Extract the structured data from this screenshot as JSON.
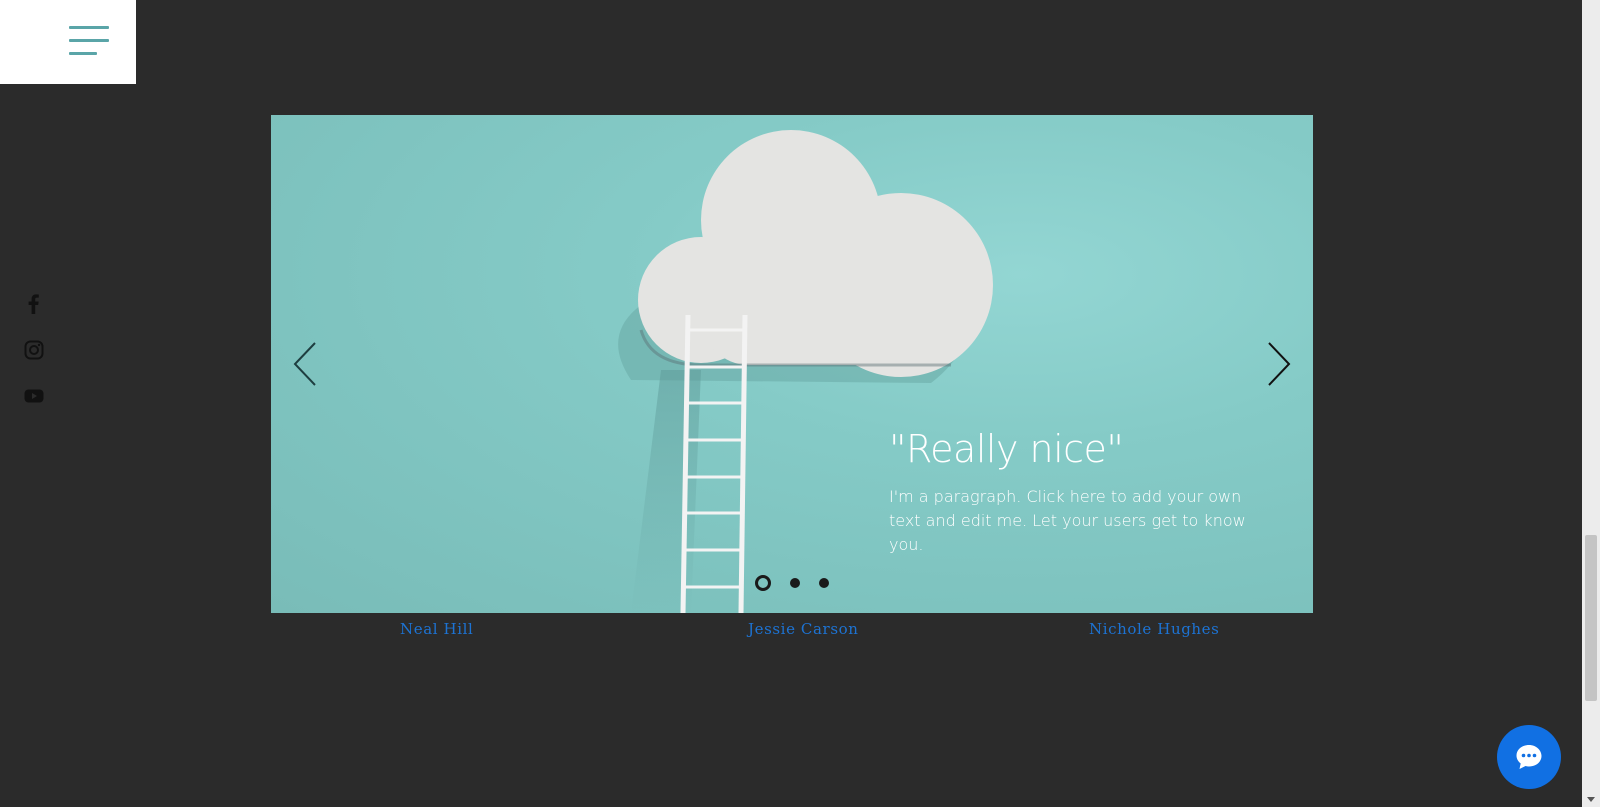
{
  "menu": {
    "icon": "hamburger-menu-icon"
  },
  "social": [
    {
      "name": "facebook",
      "icon": "facebook-icon"
    },
    {
      "name": "instagram",
      "icon": "instagram-icon"
    },
    {
      "name": "youtube",
      "icon": "youtube-icon"
    }
  ],
  "slider": {
    "prev_icon": "chevron-left-icon",
    "next_icon": "chevron-right-icon",
    "quote_title": "\"Really nice\"",
    "quote_text": "I'm a paragraph. Click here to add your own text and edit me. Let your users get to know you.",
    "background_color": "#85cbc7",
    "active_slide": 1,
    "slide_count": 3
  },
  "testimonials": {
    "names": [
      "Neal Hill",
      "Jessie Carson",
      "Nichole Hughes"
    ]
  },
  "chat": {
    "icon": "chat-bubble-icon",
    "color": "#1170e3"
  },
  "theme": {
    "page_bg": "#2b2b2b",
    "accent": "#5aa5a8",
    "link": "#1d73d3"
  }
}
